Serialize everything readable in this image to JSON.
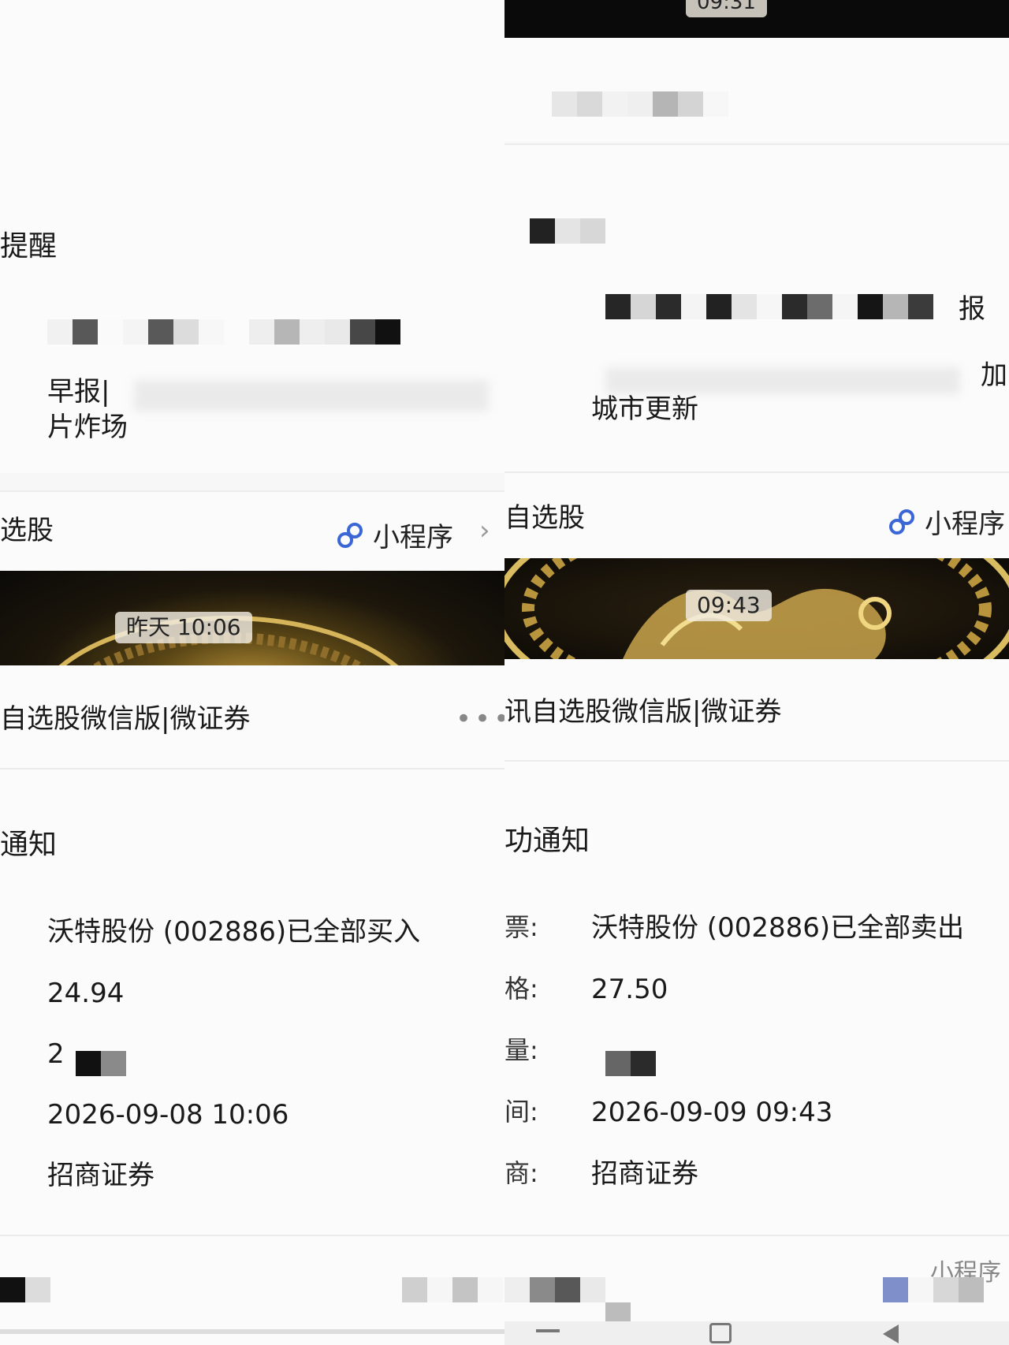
{
  "left": {
    "reminder_title_partial": "提醒",
    "news_line1_partial": "早报|",
    "news_line2": "片炸场",
    "stock_app_name_partial": "选股",
    "mini_program_label": "小程序",
    "banner_time": "昨天 10:06",
    "service_name_partial": "自选股微信版|微证券",
    "notice_title_partial": "通知",
    "stock": "沃特股份 (002886)已全部买入",
    "price": "24.94",
    "quantity_partial": "2",
    "time": "2026-09-08 10:06",
    "broker": "招商证券"
  },
  "right": {
    "top_time_partial": "09:31",
    "news_line1_tail": "报",
    "news_line2_tail": "加",
    "news_line3": "城市更新",
    "stock_app_name_partial": "自选股",
    "mini_program_label": "小程序",
    "banner_time": "09:43",
    "service_name_partial": "讯自选股微信版|微证券",
    "notice_title_partial": "功通知",
    "label_stock": "票:",
    "label_price": "格:",
    "label_qty": "量:",
    "label_time": "间:",
    "label_broker": "商:",
    "stock": "沃特股份 (002886)已全部卖出",
    "price": "27.50",
    "time": "2026-09-09 09:43",
    "broker": "招商证券",
    "bottom_partial": "小程序"
  },
  "colors": {
    "mini_program_icon": "#3a66d6",
    "banner_gold": "#b08a34"
  }
}
